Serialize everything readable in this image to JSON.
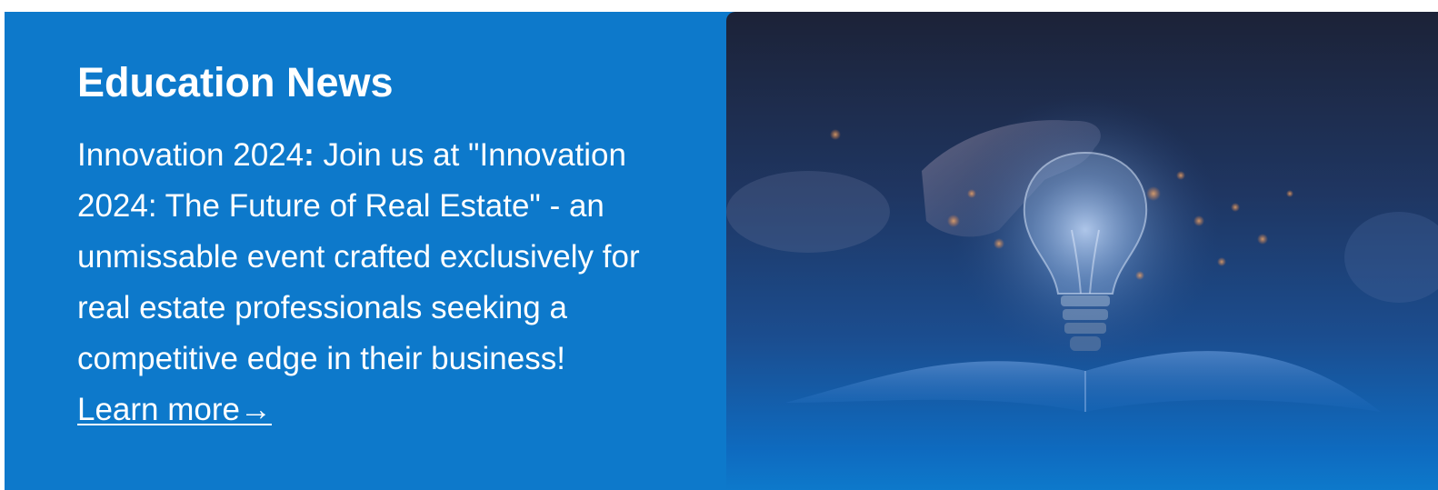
{
  "news": {
    "title": "Education News",
    "lead_highlight": "Innovation 2024",
    "lead_colon": ":",
    "body": " Join us at \"Innovation 2024: The Future of Real Estate\" - an unmissable event crafted exclusively for real estate professionals seeking a competitive edge in their business!",
    "link_label": "Learn more→"
  },
  "image": {
    "subject": "lightbulb-over-open-book"
  },
  "colors": {
    "banner_background": "#0d79cb",
    "text": "#ffffff"
  }
}
